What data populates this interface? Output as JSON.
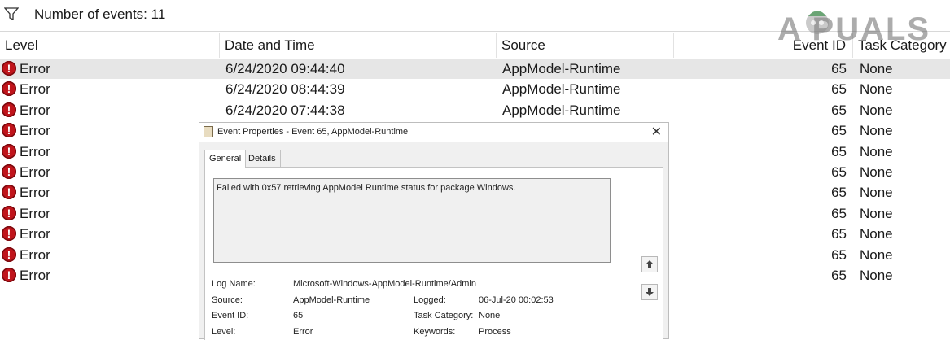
{
  "toolbar": {
    "filter_icon": "filter-icon",
    "events_label": "Number of events: 11"
  },
  "logo": {
    "text": "A PUALS"
  },
  "table": {
    "columns": [
      "Level",
      "Date and Time",
      "Source",
      "Event ID",
      "Task Category"
    ],
    "rows": [
      {
        "level": "Error",
        "date": "6/24/2020 09:44:40",
        "source": "AppModel-Runtime",
        "id": "65",
        "task": "None"
      },
      {
        "level": "Error",
        "date": "6/24/2020 08:44:39",
        "source": "AppModel-Runtime",
        "id": "65",
        "task": "None"
      },
      {
        "level": "Error",
        "date": "6/24/2020 07:44:38",
        "source": "AppModel-Runtime",
        "id": "65",
        "task": "None"
      },
      {
        "level": "Error",
        "date": "",
        "source": "",
        "id": "65",
        "task": "None"
      },
      {
        "level": "Error",
        "date": "",
        "source": "",
        "id": "65",
        "task": "None"
      },
      {
        "level": "Error",
        "date": "",
        "source": "",
        "id": "65",
        "task": "None"
      },
      {
        "level": "Error",
        "date": "",
        "source": "",
        "id": "65",
        "task": "None"
      },
      {
        "level": "Error",
        "date": "",
        "source": "",
        "id": "65",
        "task": "None"
      },
      {
        "level": "Error",
        "date": "",
        "source": "",
        "id": "65",
        "task": "None"
      },
      {
        "level": "Error",
        "date": "",
        "source": "",
        "id": "65",
        "task": "None"
      },
      {
        "level": "Error",
        "date": "",
        "source": "",
        "id": "65",
        "task": "None"
      }
    ]
  },
  "dialog": {
    "title": "Event Properties - Event 65, AppModel-Runtime",
    "close": "✕",
    "tabs": [
      "General",
      "Details"
    ],
    "description": "Failed with 0x57 retrieving AppModel Runtime status for package Windows.",
    "fields": {
      "log_name_label": "Log Name:",
      "log_name": "Microsoft-Windows-AppModel-Runtime/Admin",
      "source_label": "Source:",
      "source": "AppModel-Runtime",
      "logged_label": "Logged:",
      "logged": "06-Jul-20 00:02:53",
      "event_id_label": "Event ID:",
      "event_id": "65",
      "task_category_label": "Task Category:",
      "task_category": "None",
      "level_label": "Level:",
      "level": "Error",
      "keywords_label": "Keywords:",
      "keywords": "Process"
    }
  },
  "colors": {
    "error_red": "#c0141b",
    "selected_row": "#e6e6e6",
    "dialog_bg": "#f0f0f0"
  }
}
